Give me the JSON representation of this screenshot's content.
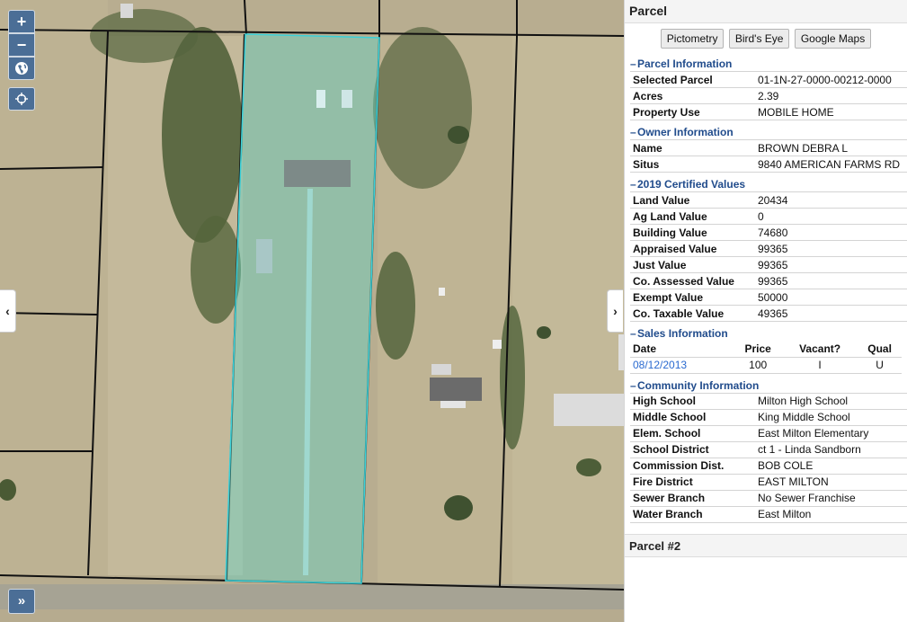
{
  "map": {
    "controls": {
      "zoom_in": "+",
      "zoom_out": "−",
      "globe_icon": "globe-icon",
      "locate_icon": "crosshair-icon",
      "expand_toolbar": "»"
    },
    "side_tabs": {
      "left": "‹",
      "right": "›"
    },
    "colors": {
      "parcel_highlight": "#5fd6c7",
      "parcel_outline": "#3ad0d8",
      "control_bg": "#4b6e96"
    }
  },
  "panel": {
    "title": "Parcel",
    "buttons": [
      "Pictometry",
      "Bird's Eye",
      "Google Maps"
    ],
    "parcel_info": {
      "title": "Parcel Information",
      "rows": [
        {
          "label": "Selected Parcel",
          "value": "01-1N-27-0000-00212-0000"
        },
        {
          "label": "Acres",
          "value": "2.39"
        },
        {
          "label": "Property Use",
          "value": "MOBILE HOME"
        }
      ]
    },
    "owner_info": {
      "title": "Owner Information",
      "rows": [
        {
          "label": "Name",
          "value": "BROWN DEBRA L"
        },
        {
          "label": "Situs",
          "value": "9840 AMERICAN FARMS RD"
        }
      ]
    },
    "certified_values": {
      "title": "2019 Certified Values",
      "rows": [
        {
          "label": "Land Value",
          "value": "20434"
        },
        {
          "label": "Ag Land Value",
          "value": "0"
        },
        {
          "label": "Building Value",
          "value": "74680"
        },
        {
          "label": "Appraised Value",
          "value": "99365"
        },
        {
          "label": "Just Value",
          "value": "99365"
        },
        {
          "label": "Co. Assessed Value",
          "value": "99365"
        },
        {
          "label": "Exempt Value",
          "value": "50000"
        },
        {
          "label": "Co. Taxable Value",
          "value": "49365"
        }
      ]
    },
    "sales_info": {
      "title": "Sales Information",
      "headers": [
        "Date",
        "Price",
        "Vacant?",
        "Qual"
      ],
      "rows": [
        {
          "date": "08/12/2013",
          "price": "100",
          "vacant": "I",
          "qual": "U"
        }
      ]
    },
    "community_info": {
      "title": "Community Information",
      "rows": [
        {
          "label": "High School",
          "value": "Milton High School"
        },
        {
          "label": "Middle School",
          "value": "King Middle School"
        },
        {
          "label": "Elem. School",
          "value": "East Milton Elementary"
        },
        {
          "label": "School District",
          "value": "ct 1 - Linda Sandborn"
        },
        {
          "label": "Commission Dist.",
          "value": "BOB COLE"
        },
        {
          "label": "Fire District",
          "value": "EAST MILTON"
        },
        {
          "label": "Sewer Branch",
          "value": "No Sewer Franchise"
        },
        {
          "label": "Water Branch",
          "value": "East Milton"
        }
      ]
    },
    "second_parcel_title": "Parcel #2"
  }
}
